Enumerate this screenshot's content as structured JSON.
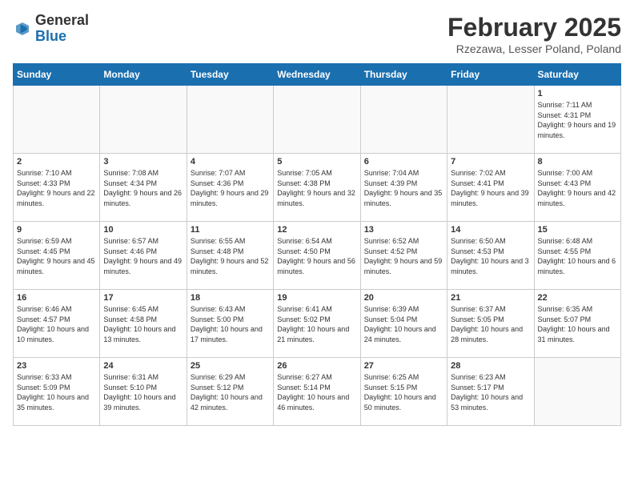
{
  "header": {
    "logo_general": "General",
    "logo_blue": "Blue",
    "title": "February 2025",
    "subtitle": "Rzezawa, Lesser Poland, Poland"
  },
  "weekdays": [
    "Sunday",
    "Monday",
    "Tuesday",
    "Wednesday",
    "Thursday",
    "Friday",
    "Saturday"
  ],
  "weeks": [
    [
      {
        "day": "",
        "sunrise": "",
        "sunset": "",
        "daylight": ""
      },
      {
        "day": "",
        "sunrise": "",
        "sunset": "",
        "daylight": ""
      },
      {
        "day": "",
        "sunrise": "",
        "sunset": "",
        "daylight": ""
      },
      {
        "day": "",
        "sunrise": "",
        "sunset": "",
        "daylight": ""
      },
      {
        "day": "",
        "sunrise": "",
        "sunset": "",
        "daylight": ""
      },
      {
        "day": "",
        "sunrise": "",
        "sunset": "",
        "daylight": ""
      },
      {
        "day": "1",
        "sunrise": "Sunrise: 7:11 AM",
        "sunset": "Sunset: 4:31 PM",
        "daylight": "Daylight: 9 hours and 19 minutes."
      }
    ],
    [
      {
        "day": "2",
        "sunrise": "Sunrise: 7:10 AM",
        "sunset": "Sunset: 4:33 PM",
        "daylight": "Daylight: 9 hours and 22 minutes."
      },
      {
        "day": "3",
        "sunrise": "Sunrise: 7:08 AM",
        "sunset": "Sunset: 4:34 PM",
        "daylight": "Daylight: 9 hours and 26 minutes."
      },
      {
        "day": "4",
        "sunrise": "Sunrise: 7:07 AM",
        "sunset": "Sunset: 4:36 PM",
        "daylight": "Daylight: 9 hours and 29 minutes."
      },
      {
        "day": "5",
        "sunrise": "Sunrise: 7:05 AM",
        "sunset": "Sunset: 4:38 PM",
        "daylight": "Daylight: 9 hours and 32 minutes."
      },
      {
        "day": "6",
        "sunrise": "Sunrise: 7:04 AM",
        "sunset": "Sunset: 4:39 PM",
        "daylight": "Daylight: 9 hours and 35 minutes."
      },
      {
        "day": "7",
        "sunrise": "Sunrise: 7:02 AM",
        "sunset": "Sunset: 4:41 PM",
        "daylight": "Daylight: 9 hours and 39 minutes."
      },
      {
        "day": "8",
        "sunrise": "Sunrise: 7:00 AM",
        "sunset": "Sunset: 4:43 PM",
        "daylight": "Daylight: 9 hours and 42 minutes."
      }
    ],
    [
      {
        "day": "9",
        "sunrise": "Sunrise: 6:59 AM",
        "sunset": "Sunset: 4:45 PM",
        "daylight": "Daylight: 9 hours and 45 minutes."
      },
      {
        "day": "10",
        "sunrise": "Sunrise: 6:57 AM",
        "sunset": "Sunset: 4:46 PM",
        "daylight": "Daylight: 9 hours and 49 minutes."
      },
      {
        "day": "11",
        "sunrise": "Sunrise: 6:55 AM",
        "sunset": "Sunset: 4:48 PM",
        "daylight": "Daylight: 9 hours and 52 minutes."
      },
      {
        "day": "12",
        "sunrise": "Sunrise: 6:54 AM",
        "sunset": "Sunset: 4:50 PM",
        "daylight": "Daylight: 9 hours and 56 minutes."
      },
      {
        "day": "13",
        "sunrise": "Sunrise: 6:52 AM",
        "sunset": "Sunset: 4:52 PM",
        "daylight": "Daylight: 9 hours and 59 minutes."
      },
      {
        "day": "14",
        "sunrise": "Sunrise: 6:50 AM",
        "sunset": "Sunset: 4:53 PM",
        "daylight": "Daylight: 10 hours and 3 minutes."
      },
      {
        "day": "15",
        "sunrise": "Sunrise: 6:48 AM",
        "sunset": "Sunset: 4:55 PM",
        "daylight": "Daylight: 10 hours and 6 minutes."
      }
    ],
    [
      {
        "day": "16",
        "sunrise": "Sunrise: 6:46 AM",
        "sunset": "Sunset: 4:57 PM",
        "daylight": "Daylight: 10 hours and 10 minutes."
      },
      {
        "day": "17",
        "sunrise": "Sunrise: 6:45 AM",
        "sunset": "Sunset: 4:58 PM",
        "daylight": "Daylight: 10 hours and 13 minutes."
      },
      {
        "day": "18",
        "sunrise": "Sunrise: 6:43 AM",
        "sunset": "Sunset: 5:00 PM",
        "daylight": "Daylight: 10 hours and 17 minutes."
      },
      {
        "day": "19",
        "sunrise": "Sunrise: 6:41 AM",
        "sunset": "Sunset: 5:02 PM",
        "daylight": "Daylight: 10 hours and 21 minutes."
      },
      {
        "day": "20",
        "sunrise": "Sunrise: 6:39 AM",
        "sunset": "Sunset: 5:04 PM",
        "daylight": "Daylight: 10 hours and 24 minutes."
      },
      {
        "day": "21",
        "sunrise": "Sunrise: 6:37 AM",
        "sunset": "Sunset: 5:05 PM",
        "daylight": "Daylight: 10 hours and 28 minutes."
      },
      {
        "day": "22",
        "sunrise": "Sunrise: 6:35 AM",
        "sunset": "Sunset: 5:07 PM",
        "daylight": "Daylight: 10 hours and 31 minutes."
      }
    ],
    [
      {
        "day": "23",
        "sunrise": "Sunrise: 6:33 AM",
        "sunset": "Sunset: 5:09 PM",
        "daylight": "Daylight: 10 hours and 35 minutes."
      },
      {
        "day": "24",
        "sunrise": "Sunrise: 6:31 AM",
        "sunset": "Sunset: 5:10 PM",
        "daylight": "Daylight: 10 hours and 39 minutes."
      },
      {
        "day": "25",
        "sunrise": "Sunrise: 6:29 AM",
        "sunset": "Sunset: 5:12 PM",
        "daylight": "Daylight: 10 hours and 42 minutes."
      },
      {
        "day": "26",
        "sunrise": "Sunrise: 6:27 AM",
        "sunset": "Sunset: 5:14 PM",
        "daylight": "Daylight: 10 hours and 46 minutes."
      },
      {
        "day": "27",
        "sunrise": "Sunrise: 6:25 AM",
        "sunset": "Sunset: 5:15 PM",
        "daylight": "Daylight: 10 hours and 50 minutes."
      },
      {
        "day": "28",
        "sunrise": "Sunrise: 6:23 AM",
        "sunset": "Sunset: 5:17 PM",
        "daylight": "Daylight: 10 hours and 53 minutes."
      },
      {
        "day": "",
        "sunrise": "",
        "sunset": "",
        "daylight": ""
      }
    ]
  ]
}
